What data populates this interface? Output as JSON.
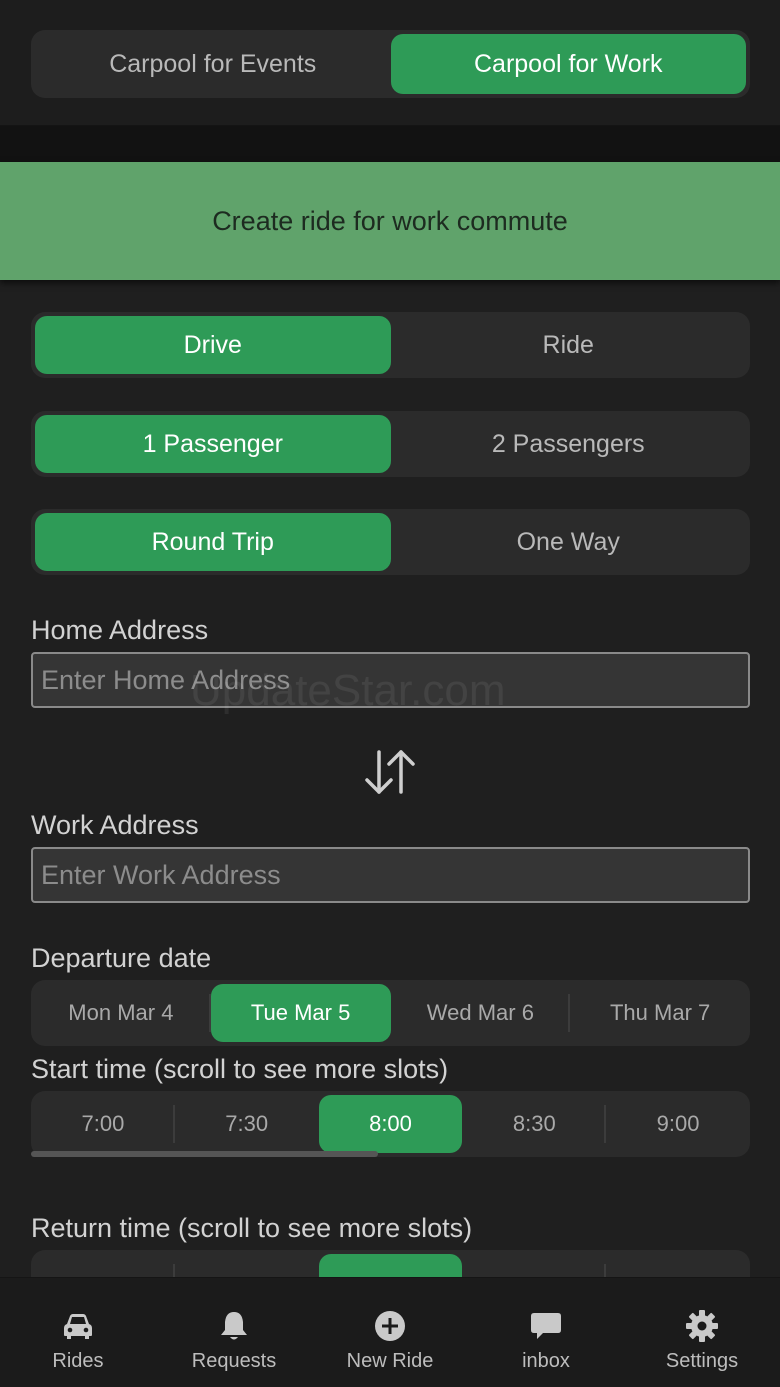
{
  "mode_tabs": [
    "Carpool for Events",
    "Carpool for Work"
  ],
  "banner": "Create ride for work commute",
  "role_options": [
    "Drive",
    "Ride"
  ],
  "passenger_options": [
    "1 Passenger",
    "2 Passengers"
  ],
  "trip_options": [
    "Round Trip",
    "One Way"
  ],
  "home": {
    "label": "Home Address",
    "placeholder": "Enter Home Address"
  },
  "work": {
    "label": "Work Address",
    "placeholder": "Enter Work Address"
  },
  "watermark": "UpdateStar.com",
  "departure": {
    "label": "Departure date",
    "dates": [
      "Mon Mar 4",
      "Tue Mar 5",
      "Wed Mar 6",
      "Thu Mar 7"
    ]
  },
  "start_time": {
    "label": "Start time (scroll to see more slots)",
    "slots": [
      "7:00",
      "7:30",
      "8:00",
      "8:30",
      "9:00"
    ]
  },
  "return_time": {
    "label": "Return time (scroll to see more slots)"
  },
  "tabbar": [
    "Rides",
    "Requests",
    "New Ride",
    "inbox",
    "Settings"
  ],
  "colors": {
    "accent": "#2e9b57",
    "banner": "#60a36b",
    "background": "#1f1f1f"
  }
}
